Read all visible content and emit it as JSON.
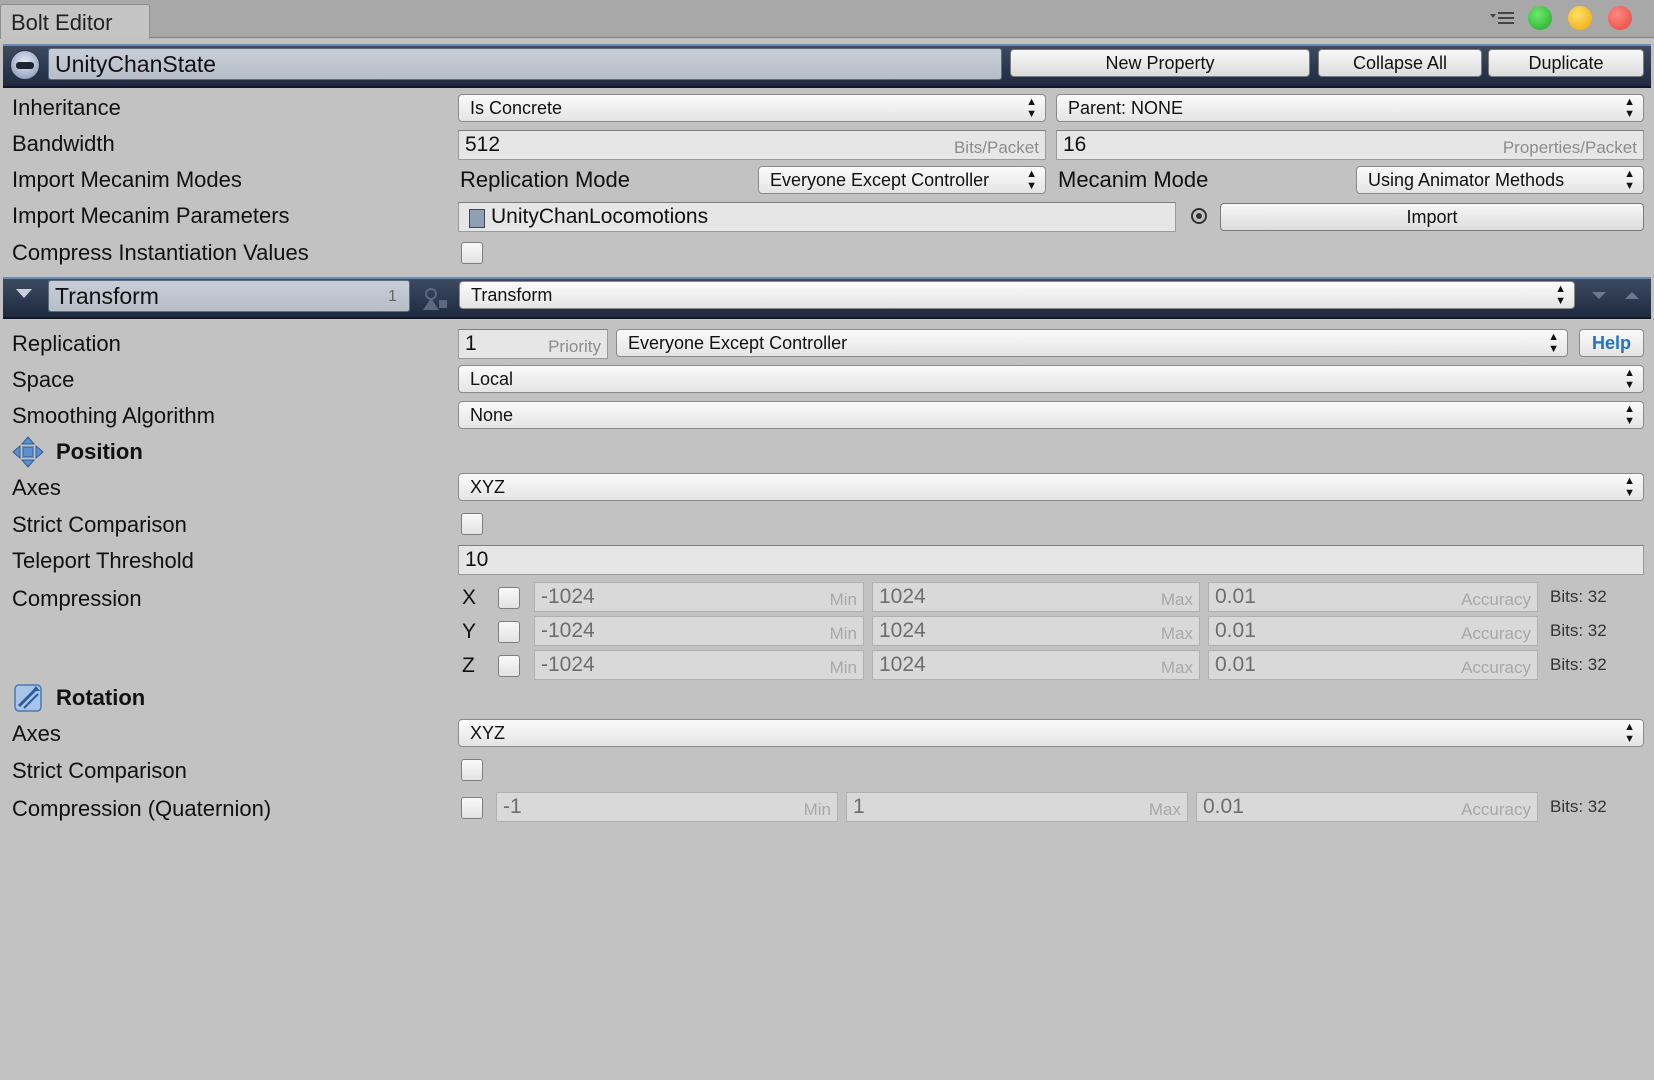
{
  "window": {
    "tab_title": "Bolt Editor",
    "traffic_lights": {
      "green": "#2fbf3a",
      "yellow": "#f4b400",
      "red": "#ed4a3e"
    }
  },
  "state_header": {
    "name": "UnityChanState",
    "buttons": {
      "new_property": "New Property",
      "collapse_all": "Collapse All",
      "duplicate": "Duplicate"
    }
  },
  "state_settings": {
    "inheritance": {
      "label": "Inheritance",
      "mode": "Is Concrete",
      "parent": "Parent: NONE"
    },
    "bandwidth": {
      "label": "Bandwidth",
      "bits_value": "512",
      "bits_hint": "Bits/Packet",
      "props_value": "16",
      "props_hint": "Properties/Packet"
    },
    "import_mecanim_modes": {
      "label": "Import Mecanim Modes",
      "replication_label": "Replication Mode",
      "replication_value": "Everyone Except Controller",
      "mecanim_label": "Mecanim Mode",
      "mecanim_value": "Using Animator Methods"
    },
    "import_mecanim_parameters": {
      "label": "Import Mecanim Parameters",
      "controller": "UnityChanLocomotions",
      "import_button": "Import"
    },
    "compress_instantiation": {
      "label": "Compress Instantiation Values",
      "checked": false
    }
  },
  "property": {
    "name": "Transform",
    "index": "1",
    "type": "Transform",
    "replication": {
      "label": "Replication",
      "priority": "1",
      "priority_hint": "Priority",
      "target": "Everyone Except Controller",
      "help": "Help"
    },
    "space": {
      "label": "Space",
      "value": "Local"
    },
    "smoothing": {
      "label": "Smoothing Algorithm",
      "value": "None"
    },
    "position": {
      "header": "Position",
      "axes_label": "Axes",
      "axes_value": "XYZ",
      "strict_label": "Strict Comparison",
      "teleport_label": "Teleport Threshold",
      "teleport_value": "10",
      "compression_label": "Compression",
      "rows": [
        {
          "axis": "X",
          "min": "-1024",
          "max": "1024",
          "accuracy": "0.01",
          "bits": "Bits: 32"
        },
        {
          "axis": "Y",
          "min": "-1024",
          "max": "1024",
          "accuracy": "0.01",
          "bits": "Bits: 32"
        },
        {
          "axis": "Z",
          "min": "-1024",
          "max": "1024",
          "accuracy": "0.01",
          "bits": "Bits: 32"
        }
      ],
      "hints": {
        "min": "Min",
        "max": "Max",
        "accuracy": "Accuracy"
      }
    },
    "rotation": {
      "header": "Rotation",
      "axes_label": "Axes",
      "axes_value": "XYZ",
      "strict_label": "Strict Comparison",
      "compression_label": "Compression (Quaternion)",
      "min": "-1",
      "max": "1",
      "accuracy": "0.01",
      "bits": "Bits: 32",
      "hints": {
        "min": "Min",
        "max": "Max",
        "accuracy": "Accuracy"
      }
    }
  }
}
